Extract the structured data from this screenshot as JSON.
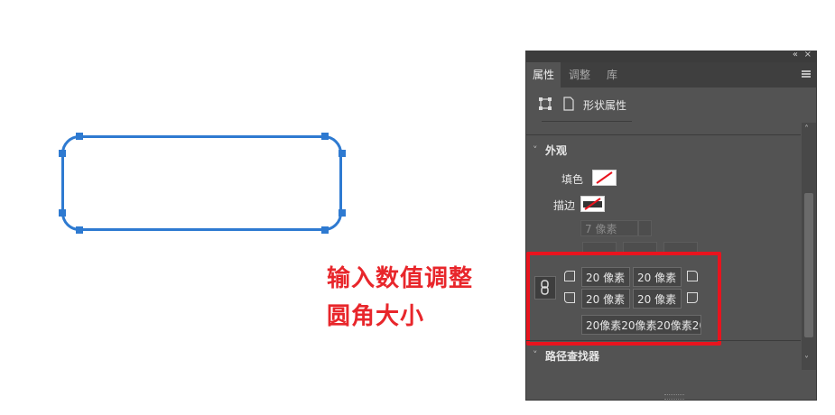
{
  "annotation": {
    "line1": "输入数值调整",
    "line2": "圆角大小"
  },
  "panel": {
    "top_controls": {
      "collapse": "«",
      "close": "×"
    },
    "tabs": [
      {
        "label": "属性"
      },
      {
        "label": "调整"
      },
      {
        "label": "库"
      }
    ],
    "shape_props_label": "形状属性",
    "appearance": {
      "title": "外观",
      "fill_label": "填色",
      "stroke_label": "描边",
      "stroke_width": "7 像素"
    },
    "corners": {
      "top_left": "20 像素",
      "top_right": "20 像素",
      "bottom_left": "20 像素",
      "bottom_right": "20 像素",
      "combined": "20像素20像素20像素20像"
    },
    "pathfinder_title": "路径查找器"
  },
  "colors": {
    "shape_stroke": "#2e7ad1",
    "annotation": "#e8262b",
    "highlight_box": "#e8141e",
    "panel_bg": "#535353"
  }
}
